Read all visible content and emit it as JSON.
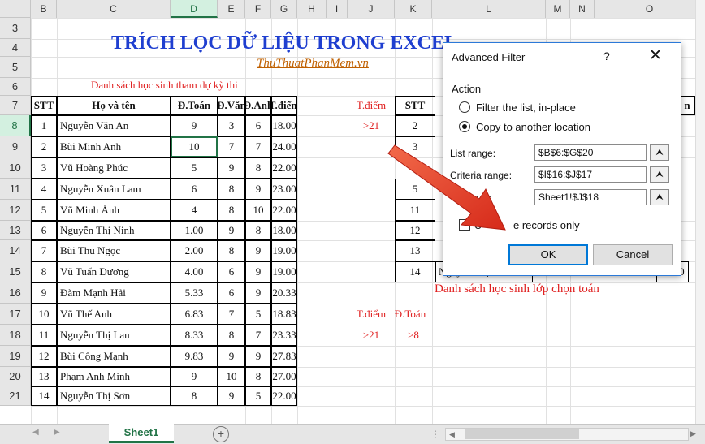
{
  "sheet": {
    "columns": [
      "B",
      "C",
      "D",
      "E",
      "F",
      "G",
      "H",
      "I",
      "J",
      "K",
      "L",
      "M",
      "N",
      "O"
    ],
    "rows": [
      "3",
      "4",
      "5",
      "6",
      "7",
      "8",
      "9",
      "10",
      "11",
      "12",
      "13",
      "14",
      "15",
      "16",
      "17",
      "18",
      "19",
      "20",
      "21"
    ],
    "title": "TRÍCH LỌC DỮ LIỆU TRONG EXCEL",
    "watermark": "ThuThuatPhanMem.vn",
    "list_caption": "Danh sách học sinh tham dự kỳ thi",
    "result_caption": "Danh sách học sinh lớp chọn toán",
    "headers": [
      "STT",
      "Họ và tên",
      "Đ.Toán",
      "Đ.Văn",
      "Đ.Anh",
      "T.điểm"
    ],
    "students": [
      [
        "1",
        "Nguyễn Văn An",
        "9",
        "3",
        "6",
        "18.00"
      ],
      [
        "2",
        "Bùi Minh Anh",
        "10",
        "7",
        "7",
        "24.00"
      ],
      [
        "3",
        "Vũ Hoàng Phúc",
        "5",
        "9",
        "8",
        "22.00"
      ],
      [
        "4",
        "Nguyễn Xuân Lam",
        "6",
        "8",
        "9",
        "23.00"
      ],
      [
        "5",
        "Vũ Minh Ánh",
        "4",
        "8",
        "10",
        "22.00"
      ],
      [
        "6",
        "Nguyễn Thị Ninh",
        "1.00",
        "9",
        "8",
        "18.00"
      ],
      [
        "7",
        "Bùi Thu Ngọc",
        "2.00",
        "8",
        "9",
        "19.00"
      ],
      [
        "8",
        "Vũ Tuấn Dương",
        "4.00",
        "6",
        "9",
        "19.00"
      ],
      [
        "9",
        "Đàm Mạnh Hải",
        "5.33",
        "6",
        "9",
        "20.33"
      ],
      [
        "10",
        "Vũ Thế Anh",
        "6.83",
        "7",
        "5",
        "18.83"
      ],
      [
        "11",
        "Nguyễn Thị Lan",
        "8.33",
        "8",
        "7",
        "23.33"
      ],
      [
        "12",
        "Bùi Công Mạnh",
        "9.83",
        "9",
        "9",
        "27.83"
      ],
      [
        "13",
        "Phạm Anh Minh",
        "9",
        "10",
        "8",
        "27.00"
      ],
      [
        "14",
        "Nguyễn Thị Sơn",
        "8",
        "9",
        "5",
        "22.00"
      ]
    ],
    "criteria1_header": "T.điểm",
    "criteria1_value": ">21",
    "criteria2_headers": [
      "T.điểm",
      "Đ.Toán"
    ],
    "criteria2_values": [
      ">21",
      ">8"
    ],
    "result_header_stt": "STT",
    "result_header_tail": "n",
    "result_stt": [
      "2",
      "3",
      "",
      "5",
      "11",
      "12",
      "13",
      "14"
    ],
    "result_partial_name": "Nguyễn Thị Sơn",
    "result_partial_tail": "22.00"
  },
  "dialog": {
    "title": "Advanced Filter",
    "help": "?",
    "close": "✕",
    "action_label": "Action",
    "option_filter": "Filter the list, in-place",
    "option_copy": "Copy to another location",
    "list_range_label": "List range:",
    "list_range_value": "$B$6:$G$20",
    "criteria_range_label": "Criteria range:",
    "criteria_range_value": "$I$16:$J$17",
    "copy_to_label": "py to:",
    "copy_to_value": "Sheet1!$J$18",
    "unique_label_a": "U",
    "unique_label_b": "e records only",
    "ok": "OK",
    "cancel": "Cancel",
    "range_btn": "⮝"
  },
  "tabs": {
    "sheet1": "Sheet1",
    "add": "+"
  }
}
